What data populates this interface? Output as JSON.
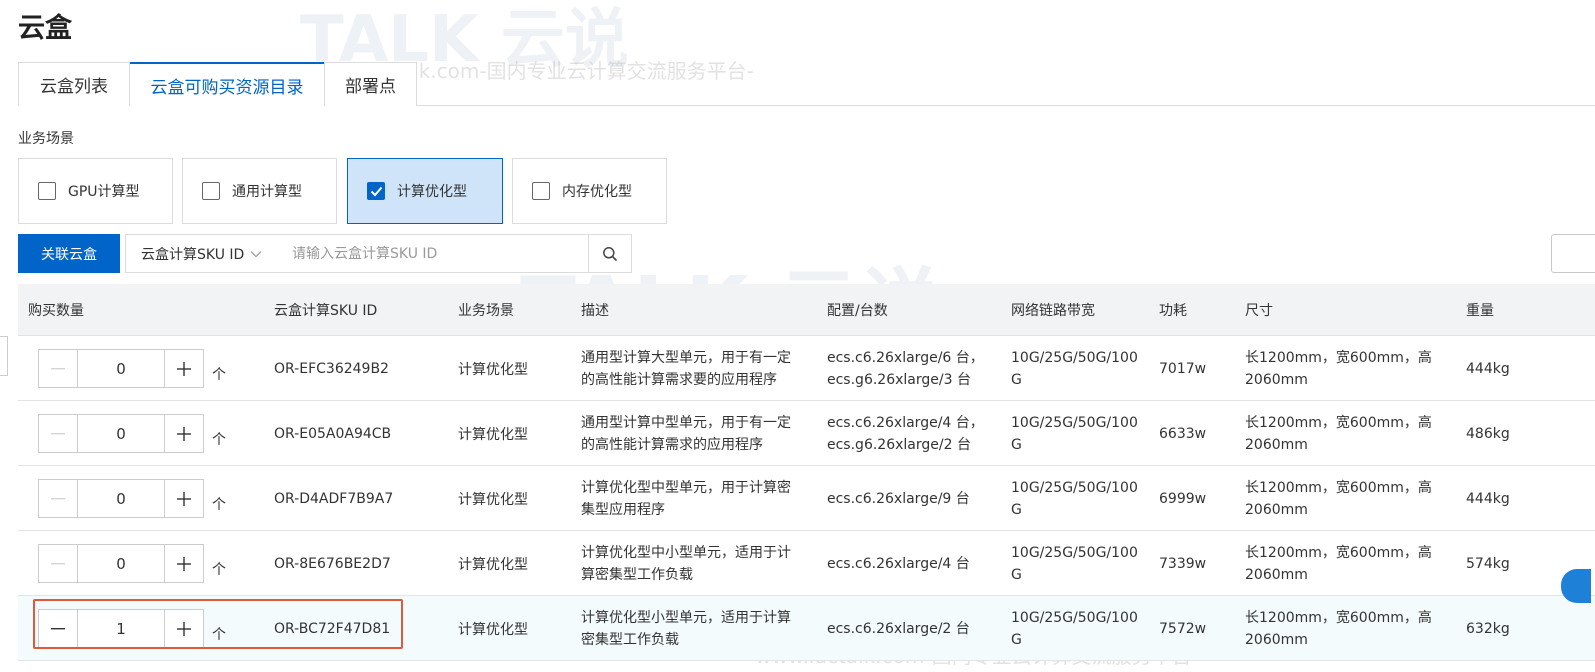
{
  "page": {
    "title": "云盒"
  },
  "tabs": [
    {
      "label": "云盒列表",
      "active": false
    },
    {
      "label": "云盒可购买资源目录",
      "active": true
    },
    {
      "label": "部署点",
      "active": false
    }
  ],
  "scene_filter": {
    "label": "业务场景",
    "options": [
      {
        "label": "GPU计算型",
        "checked": false
      },
      {
        "label": "通用计算型",
        "checked": false
      },
      {
        "label": "计算优化型",
        "checked": true
      },
      {
        "label": "内存优化型",
        "checked": false
      }
    ]
  },
  "toolbar": {
    "link_button": "关联云盒",
    "filter_select": "云盒计算SKU ID",
    "search_placeholder": "请输入云盒计算SKU ID"
  },
  "table": {
    "columns": [
      "购买数量",
      "云盒计算SKU ID",
      "业务场景",
      "描述",
      "配置/台数",
      "网络链路带宽",
      "功耗",
      "尺寸",
      "重量"
    ],
    "unit": "个",
    "rows": [
      {
        "qty": "0",
        "sku": "OR-EFC36249B2",
        "scene": "计算优化型",
        "desc_1": "通用型计算大型单元，用于有一定",
        "desc_2": "的高性能计算需求要的应用程序",
        "config_1": "ecs.c6.26xlarge/6 台，",
        "config_2": "ecs.g6.26xlarge/3 台",
        "net_1": "10G/25G/50G/100",
        "net_2": "G",
        "power": "7017w",
        "size_1": "长1200mm，宽600mm，高",
        "size_2": "2060mm",
        "weight": "444kg",
        "selected": false
      },
      {
        "qty": "0",
        "sku": "OR-E05A0A94CB",
        "scene": "计算优化型",
        "desc_1": "通用型计算中型单元，用于有一定",
        "desc_2": "的高性能计算需求的应用程序",
        "config_1": "ecs.c6.26xlarge/4 台，",
        "config_2": "ecs.g6.26xlarge/2 台",
        "net_1": "10G/25G/50G/100",
        "net_2": "G",
        "power": "6633w",
        "size_1": "长1200mm，宽600mm，高",
        "size_2": "2060mm",
        "weight": "486kg",
        "selected": false
      },
      {
        "qty": "0",
        "sku": "OR-D4ADF7B9A7",
        "scene": "计算优化型",
        "desc_1": "计算优化型中型单元，用于计算密",
        "desc_2": "集型应用程序",
        "config_1": "ecs.c6.26xlarge/9 台",
        "config_2": "",
        "net_1": "10G/25G/50G/100",
        "net_2": "G",
        "power": "6999w",
        "size_1": "长1200mm，宽600mm，高",
        "size_2": "2060mm",
        "weight": "444kg",
        "selected": false
      },
      {
        "qty": "0",
        "sku": "OR-8E676BE2D7",
        "scene": "计算优化型",
        "desc_1": "计算优化型中小型单元，适用于计",
        "desc_2": "算密集型工作负载",
        "config_1": "ecs.c6.26xlarge/4 台",
        "config_2": "",
        "net_1": "10G/25G/50G/100",
        "net_2": "G",
        "power": "7339w",
        "size_1": "长1200mm，宽600mm，高",
        "size_2": "2060mm",
        "weight": "574kg",
        "selected": false
      },
      {
        "qty": "1",
        "sku": "OR-BC72F47D81",
        "scene": "计算优化型",
        "desc_1": "计算优化型小型单元，适用于计算",
        "desc_2": "密集型工作负载",
        "config_1": "ecs.c6.26xlarge/2 台",
        "config_2": "",
        "net_1": "10G/25G/50G/100",
        "net_2": "G",
        "power": "7572w",
        "size_1": "长1200mm，宽600mm，高",
        "size_2": "2060mm",
        "weight": "632kg",
        "selected": true
      }
    ]
  },
  "watermark": {
    "brand": "TALK",
    "brand_cn": "云说",
    "text": "-www.idctalk.com-国内专业云计算交流服务平台-"
  },
  "colors": {
    "accent": "#0064c8",
    "highlight": "#e0593a",
    "checked_bg": "#cfe4f8"
  },
  "icons": {
    "search": "search-icon",
    "check": "check-icon",
    "chevron": "chevron-down-icon",
    "minus": "minus-icon",
    "plus": "plus-icon"
  }
}
